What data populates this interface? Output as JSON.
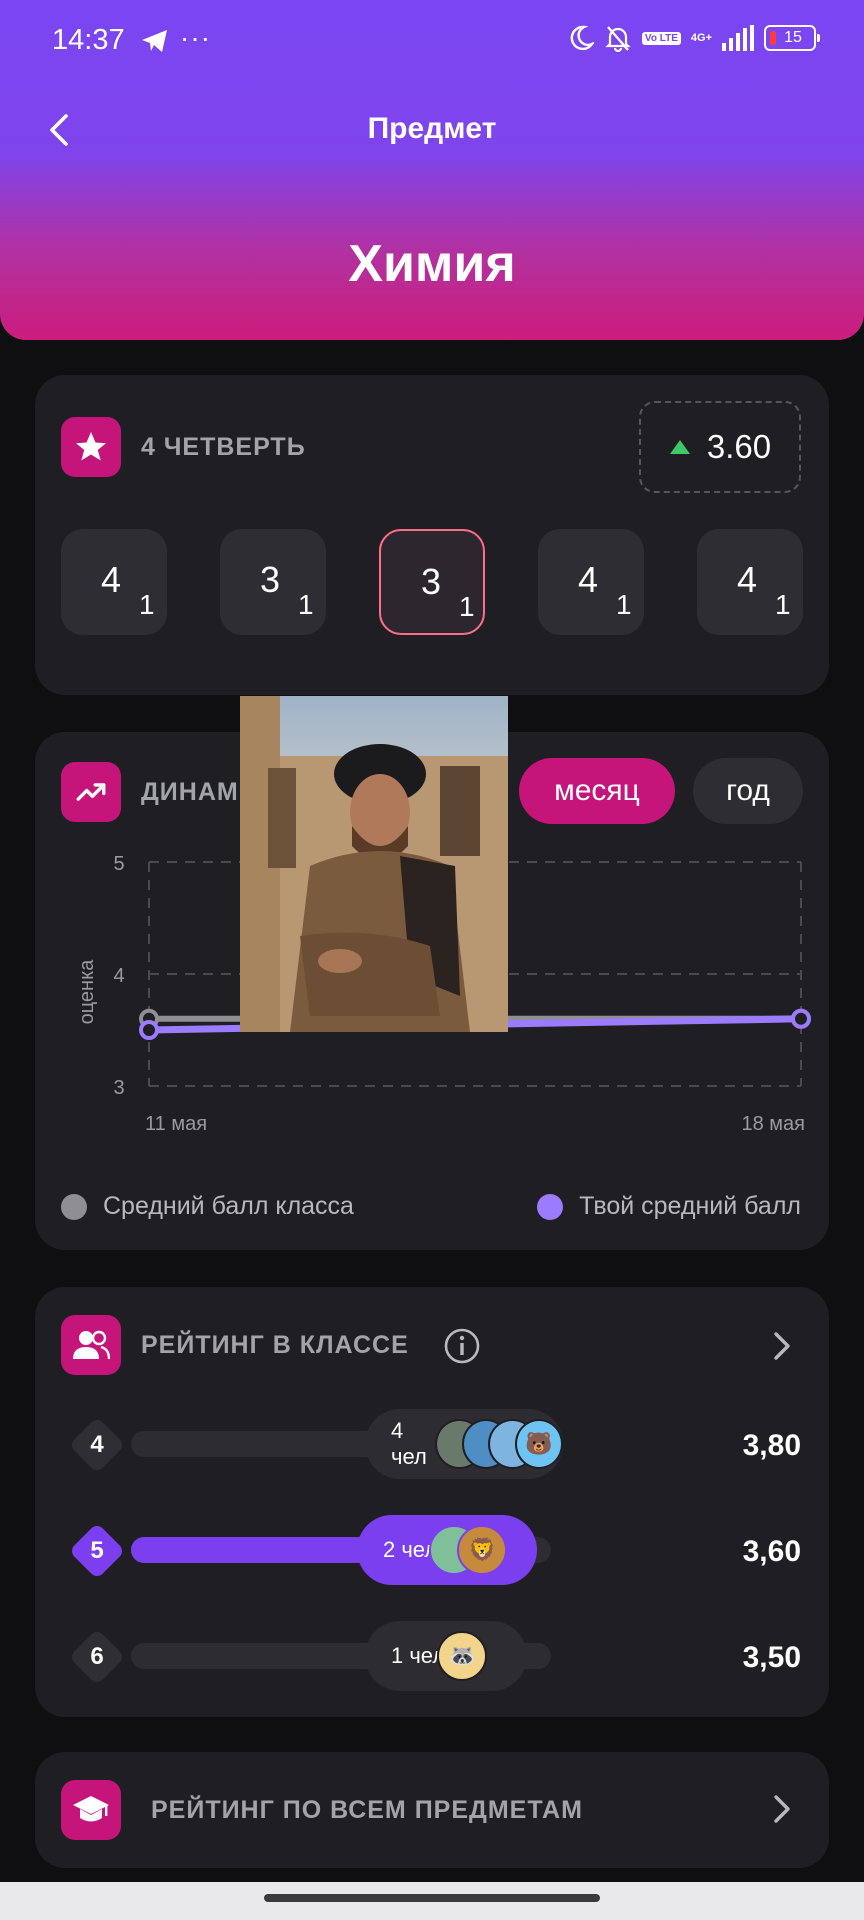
{
  "status_bar": {
    "time": "14:37",
    "overflow": "···",
    "volte": "Vo LTE",
    "network": "4G+",
    "battery": "15"
  },
  "header": {
    "title": "Предмет",
    "subject": "Химия"
  },
  "quarter": {
    "label": "4 ЧЕТВЕРТЬ",
    "average": "3.60",
    "trend_color": "#3ec76b",
    "grades": [
      {
        "grade": "4",
        "weight": "1"
      },
      {
        "grade": "3",
        "weight": "1"
      },
      {
        "grade": "3",
        "weight": "1"
      },
      {
        "grade": "4",
        "weight": "1"
      },
      {
        "grade": "4",
        "weight": "1"
      }
    ]
  },
  "dynamics": {
    "label_visible": "ДИНАМ",
    "segments": [
      "месяц",
      "год"
    ],
    "selected_segment": "месяц",
    "legend": {
      "class": "Средний балл класса",
      "mine": "Твой средний балл"
    }
  },
  "chart_data": {
    "type": "line",
    "ylabel": "оценка",
    "ylim": [
      3,
      5
    ],
    "yticks": [
      "5",
      "4",
      "3"
    ],
    "x": [
      "11 мая",
      "18 мая"
    ],
    "series": [
      {
        "name": "Средний балл класса",
        "color": "#8e8e93",
        "values": [
          3.6,
          3.6
        ]
      },
      {
        "name": "Твой средний балл",
        "color": "#9b7bff",
        "values": [
          3.5,
          3.6
        ]
      }
    ]
  },
  "class_rating": {
    "label": "РЕЙТИНГ В КЛАССЕ",
    "rows": [
      {
        "rank": "4",
        "count": "4 чел",
        "score": "3,80",
        "highlight": false,
        "fill": 0
      },
      {
        "rank": "5",
        "count": "2 чел",
        "score": "3,60",
        "highlight": true,
        "fill": 0.74
      },
      {
        "rank": "6",
        "count": "1 чел",
        "score": "3,50",
        "highlight": false,
        "fill": 0
      }
    ]
  },
  "all_subjects": {
    "label": "РЕЙТИНГ ПО ВСЕМ ПРЕДМЕТАМ"
  },
  "colors": {
    "accent": "#c5157a",
    "purple": "#7b3ff0",
    "card": "#1f1f23"
  }
}
